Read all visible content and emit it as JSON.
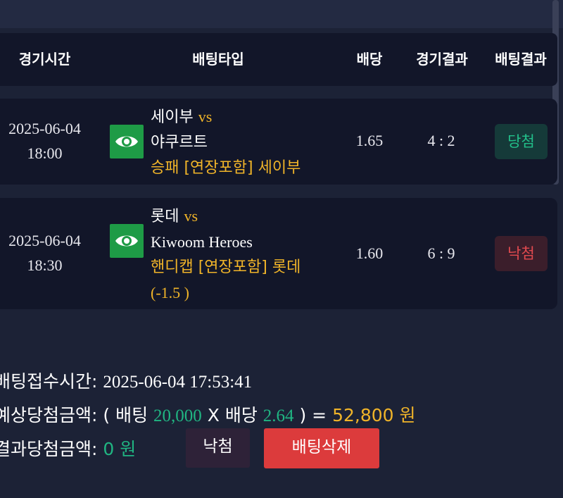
{
  "header": {
    "col_time": "경기시간",
    "col_type": "배팅타입",
    "col_odds": "배당",
    "col_score": "경기결과",
    "col_result": "배팅결과"
  },
  "rows": [
    {
      "date": "2025-06-04",
      "time": "18:00",
      "home": "세이부",
      "vs": "vs",
      "away": "야쿠르트",
      "pick_line1": "승패 [연장포함] 세이부",
      "pick_line2": "",
      "odds": "1.65",
      "score": "4 : 2",
      "result": "당첨",
      "icon": "eye-icon"
    },
    {
      "date": "2025-06-04",
      "time": "18:30",
      "home": "롯데",
      "vs": "vs",
      "away": "Kiwoom Heroes",
      "pick_line1": "핸디캡 [연장포함] 롯데",
      "pick_line2": "(-1.5 )",
      "odds": "1.60",
      "score": "6 : 9",
      "result": "낙첨",
      "icon": "eye-icon"
    }
  ],
  "summary": {
    "received_label": "배팅접수시간:",
    "received_value": "2025-06-04 17:53:41",
    "expected_label": "예상당첨금액:",
    "expected_open": "( 배팅",
    "stake": "20,000",
    "x_label": "X 배당",
    "total_odds": "2.64",
    "expected_close": ") =",
    "expected_amount": "52,800 원",
    "actual_label": "결과당첨금액:",
    "actual_amount": "0 원"
  },
  "buttons": {
    "result_label": "낙첨",
    "delete_label": "배팅삭제"
  },
  "colors": {
    "background": "#1c2236",
    "row": "#121629",
    "accent_gold": "#f0b429",
    "win_green": "#22c08a",
    "lose_red": "#e24a4f",
    "delete_red": "#dc3b3c",
    "icon_green": "#1e9b46"
  }
}
